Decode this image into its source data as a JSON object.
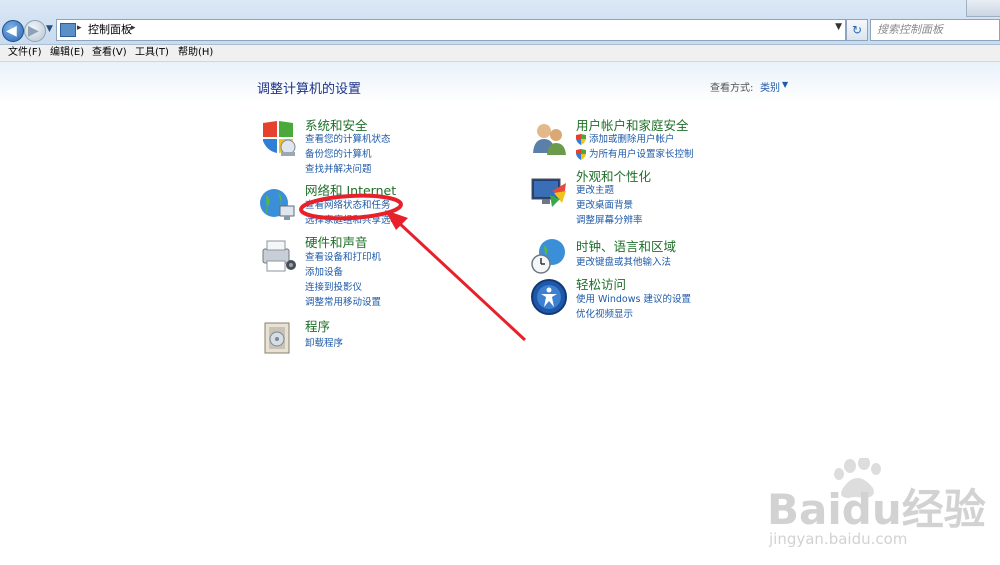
{
  "address_bar": {
    "path": "控制面板",
    "search_placeholder": "搜索控制面板"
  },
  "menu": {
    "items": [
      "文件(F)",
      "编辑(E)",
      "查看(V)",
      "工具(T)",
      "帮助(H)"
    ]
  },
  "main": {
    "title": "调整计算机的设置",
    "view_by_label": "查看方式:",
    "view_by_value": "类别"
  },
  "categories": {
    "system": {
      "title": "系统和安全",
      "links": [
        "查看您的计算机状态",
        "备份您的计算机",
        "查找并解决问题"
      ]
    },
    "network": {
      "title": "网络和 Internet",
      "links": [
        "查看网络状态和任务",
        "选择家庭组和共享选项"
      ]
    },
    "hardware": {
      "title": "硬件和声音",
      "links": [
        "查看设备和打印机",
        "添加设备",
        "连接到投影仪",
        "调整常用移动设置"
      ]
    },
    "programs": {
      "title": "程序",
      "links": [
        "卸载程序"
      ]
    },
    "users": {
      "title": "用户帐户和家庭安全",
      "links": [
        "添加或删除用户帐户",
        "为所有用户设置家长控制"
      ]
    },
    "appearance": {
      "title": "外观和个性化",
      "links": [
        "更改主题",
        "更改桌面背景",
        "调整屏幕分辨率"
      ]
    },
    "clock": {
      "title": "时钟、语言和区域",
      "links": [
        "更改键盘或其他输入法"
      ]
    },
    "access": {
      "title": "轻松访问",
      "links": [
        "使用 Windows 建议的设置",
        "优化视频显示"
      ]
    }
  },
  "watermark": {
    "brand": "Baidu经验",
    "url": "jingyan.baidu.com"
  },
  "colors": {
    "title": "#1e3287",
    "category": "#1e6f28",
    "link": "#1e5aa8",
    "annotation": "#e8202a"
  }
}
